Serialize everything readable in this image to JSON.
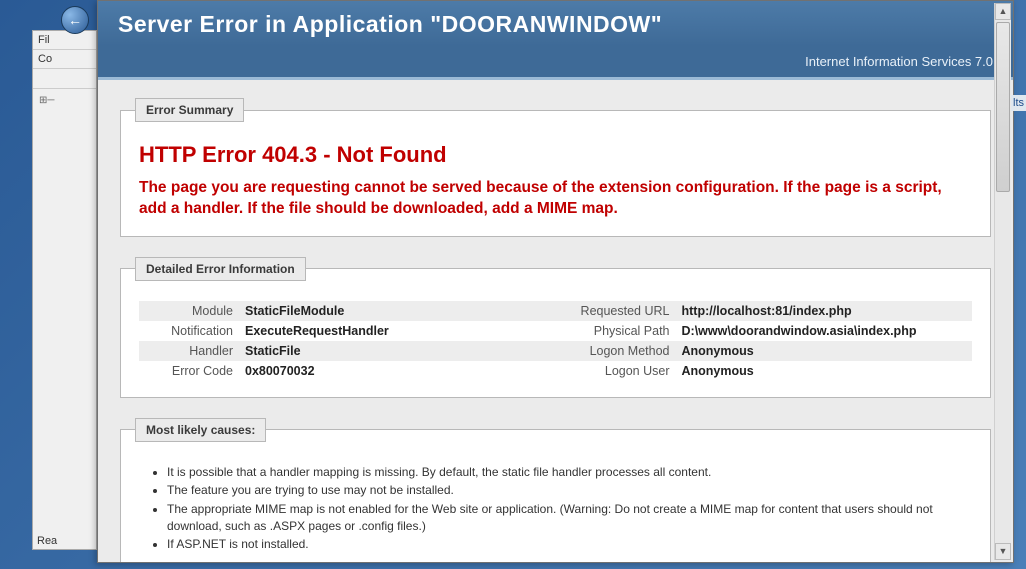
{
  "left_panel": {
    "fil": "Fil",
    "co": "Co",
    "rea": "Rea"
  },
  "header": {
    "title": "Server Error in Application \"DOORANWINDOW\"",
    "subtitle": "Internet Information Services 7.0"
  },
  "summary": {
    "legend": "Error Summary",
    "error_title": "HTTP Error 404.3 - Not Found",
    "error_desc": "The page you are requesting cannot be served because of the extension configuration. If the page is a script, add a handler. If the file should be downloaded, add a MIME map."
  },
  "details": {
    "legend": "Detailed Error Information",
    "left": [
      {
        "label": "Module",
        "value": "StaticFileModule"
      },
      {
        "label": "Notification",
        "value": "ExecuteRequestHandler"
      },
      {
        "label": "Handler",
        "value": "StaticFile"
      },
      {
        "label": "Error Code",
        "value": "0x80070032"
      }
    ],
    "right": [
      {
        "label": "Requested URL",
        "value": "http://localhost:81/index.php"
      },
      {
        "label": "Physical Path",
        "value": "D:\\www\\doorandwindow.asia\\index.php"
      },
      {
        "label": "Logon Method",
        "value": "Anonymous"
      },
      {
        "label": "Logon User",
        "value": "Anonymous"
      }
    ]
  },
  "causes": {
    "legend": "Most likely causes:",
    "items": [
      "It is possible that a handler mapping is missing. By default, the static file handler processes all content.",
      "The feature you are trying to use may not be installed.",
      "The appropriate MIME map is not enabled for the Web site or application. (Warning: Do not create a MIME map for content that users should not download, such as .ASPX pages or .config files.)",
      "If ASP.NET is not installed."
    ]
  },
  "right_label": "lts"
}
